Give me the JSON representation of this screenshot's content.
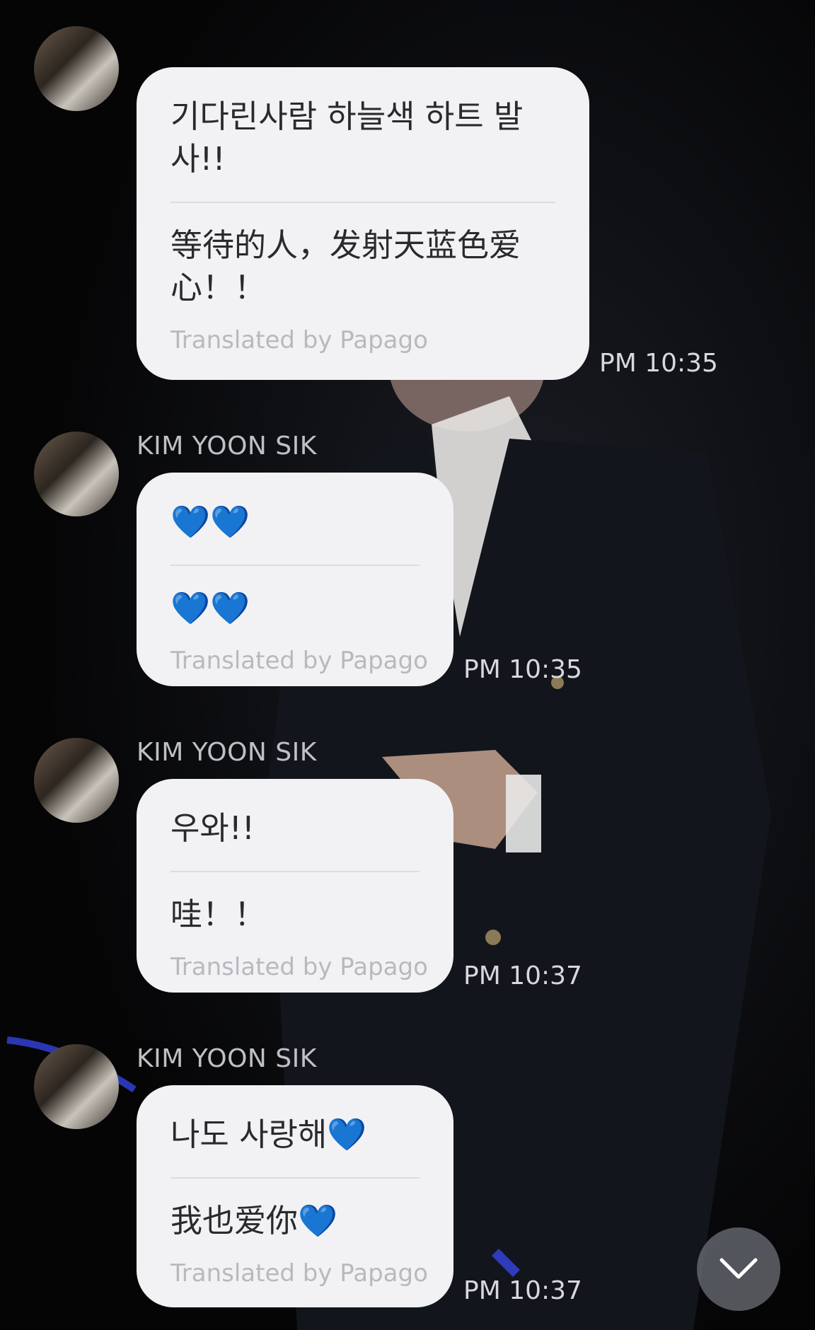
{
  "messages": [
    {
      "sender": "",
      "original": "기다린사람 하늘색 하트 발사!!",
      "translation": "等待的人，发射天蓝色爱心！！",
      "translated_by": "Translated by Papago",
      "time": "PM 10:35"
    },
    {
      "sender": "KIM YOON SIK",
      "original": "💙💙",
      "translation": "💙💙",
      "translated_by": "Translated by Papago",
      "time": "PM 10:35"
    },
    {
      "sender": "KIM YOON SIK",
      "original": "우와!!",
      "translation": "哇！！",
      "translated_by": "Translated by Papago",
      "time": "PM 10:37"
    },
    {
      "sender": "KIM YOON SIK",
      "original": "나도 사랑해💙",
      "translation": "我也爱你💙",
      "translated_by": "Translated by Papago",
      "time": "PM 10:37"
    }
  ],
  "icons": {
    "scroll_down": "chevron-down-icon",
    "avatar": "profile-avatar"
  },
  "colors": {
    "bubble": "#f2f2f5",
    "heart": "#3fc4e6",
    "background": "#050505"
  }
}
